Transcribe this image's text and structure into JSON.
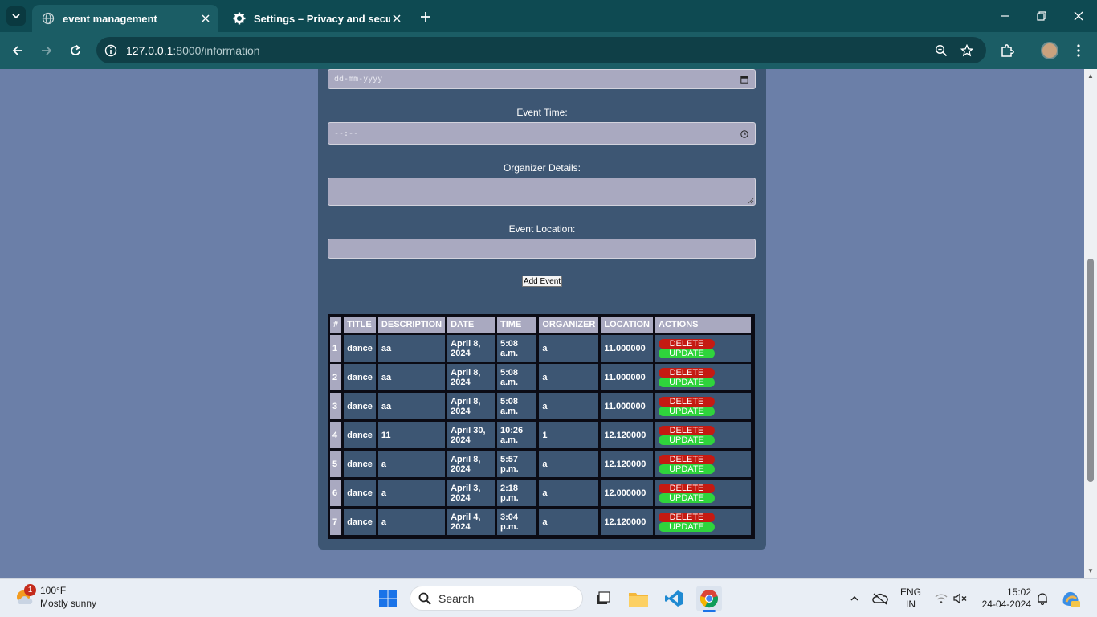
{
  "browser": {
    "tabs": [
      {
        "title": "event management",
        "active": true
      },
      {
        "title": "Settings – Privacy and security",
        "active": false
      }
    ],
    "url_host": "127.0.0.1",
    "url_path": ":8000/information"
  },
  "form": {
    "date_placeholder": "dd-mm-yyyy",
    "time_label": "Event Time:",
    "time_placeholder": "--:--",
    "organizer_label": "Organizer Details:",
    "location_label": "Event Location:",
    "add_button": "Add Event"
  },
  "table": {
    "headers": [
      "#",
      "TITLE",
      "DESCRIPTION",
      "DATE",
      "TIME",
      "ORGANIZER",
      "LOCATION",
      "ACTIONS"
    ],
    "delete_label": "DELETE",
    "update_label": "UPDATE",
    "rows": [
      {
        "num": "1",
        "title": "dance",
        "description": "aa",
        "date": "April 8, 2024",
        "time": "5:08 a.m.",
        "organizer": "a",
        "location": "11.000000"
      },
      {
        "num": "2",
        "title": "dance",
        "description": "aa",
        "date": "April 8, 2024",
        "time": "5:08 a.m.",
        "organizer": "a",
        "location": "11.000000"
      },
      {
        "num": "3",
        "title": "dance",
        "description": "aa",
        "date": "April 8, 2024",
        "time": "5:08 a.m.",
        "organizer": "a",
        "location": "11.000000"
      },
      {
        "num": "4",
        "title": "dance",
        "description": "11",
        "date": "April 30, 2024",
        "time": "10:26 a.m.",
        "organizer": "1",
        "location": "12.120000"
      },
      {
        "num": "5",
        "title": "dance",
        "description": "a",
        "date": "April 8, 2024",
        "time": "5:57 p.m.",
        "organizer": "a",
        "location": "12.120000"
      },
      {
        "num": "6",
        "title": "dance",
        "description": "a",
        "date": "April 3, 2024",
        "time": "2:18 p.m.",
        "organizer": "a",
        "location": "12.000000"
      },
      {
        "num": "7",
        "title": "dance",
        "description": "a",
        "date": "April 4, 2024",
        "time": "3:04 p.m.",
        "organizer": "a",
        "location": "12.120000"
      }
    ]
  },
  "taskbar": {
    "weather_temp": "100°F",
    "weather_desc": "Mostly sunny",
    "weather_badge": "1",
    "search_label": "Search",
    "lang_line1": "ENG",
    "lang_line2": "IN",
    "time": "15:02",
    "date": "24-04-2024"
  },
  "colors": {
    "page_bg": "#6b7fa8",
    "panel_bg": "#3d5673",
    "delete": "#c51a12",
    "update": "#2fd43c",
    "chrome": "#1b5d65"
  }
}
